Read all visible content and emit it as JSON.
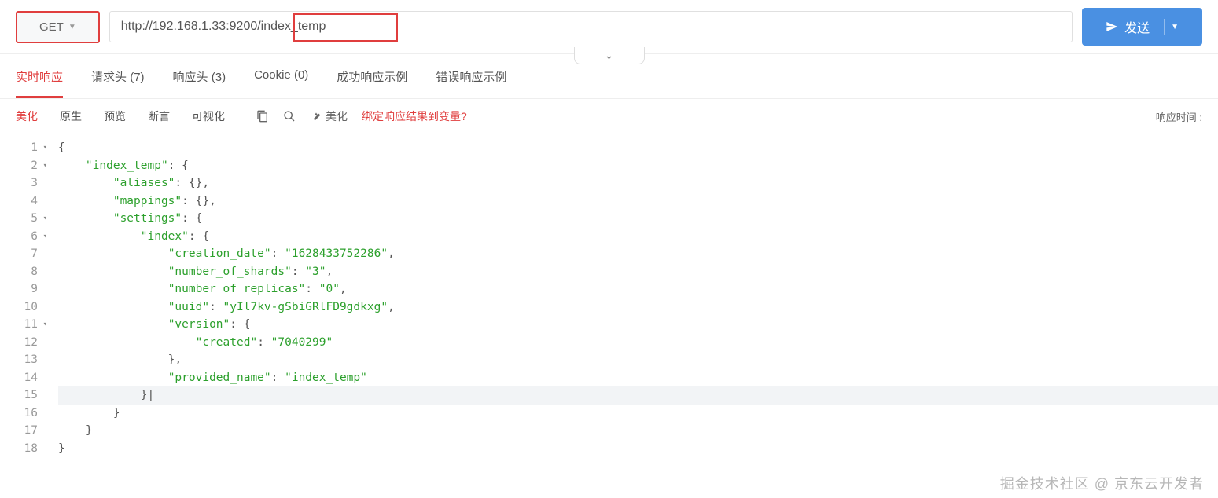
{
  "request": {
    "method": "GET",
    "url": "http://192.168.1.33:9200/index_temp"
  },
  "send_button": "发送",
  "main_tabs": [
    {
      "label": "实时响应",
      "count": ""
    },
    {
      "label": "请求头",
      "count": "(7)"
    },
    {
      "label": "响应头",
      "count": "(3)"
    },
    {
      "label": "Cookie",
      "count": "(0)"
    },
    {
      "label": "成功响应示例",
      "count": ""
    },
    {
      "label": "错误响应示例",
      "count": ""
    }
  ],
  "sub_tabs": [
    "美化",
    "原生",
    "预览",
    "断言",
    "可视化"
  ],
  "toolbar": {
    "beautify": "美化",
    "bind_vars": "绑定响应结果到变量?"
  },
  "response_time_label": "响应时间 :",
  "code": {
    "line_numbers": [
      "1",
      "2",
      "3",
      "4",
      "5",
      "6",
      "7",
      "8",
      "9",
      "10",
      "11",
      "12",
      "13",
      "14",
      "15",
      "16",
      "17",
      "18"
    ],
    "fold_lines": [
      1,
      2,
      5,
      6,
      11
    ],
    "lines": [
      "{",
      "    \"index_temp\": {",
      "        \"aliases\": {},",
      "        \"mappings\": {},",
      "        \"settings\": {",
      "            \"index\": {",
      "                \"creation_date\": \"1628433752286\",",
      "                \"number_of_shards\": \"3\",",
      "                \"number_of_replicas\": \"0\",",
      "                \"uuid\": \"yIl7kv-gSbiGRlFD9gdkxg\",",
      "                \"version\": {",
      "                    \"created\": \"7040299\"",
      "                },",
      "                \"provided_name\": \"index_temp\"",
      "            }|",
      "        }",
      "    }",
      "}"
    ]
  },
  "watermark": "掘金技术社区 @ 京东云开发者"
}
